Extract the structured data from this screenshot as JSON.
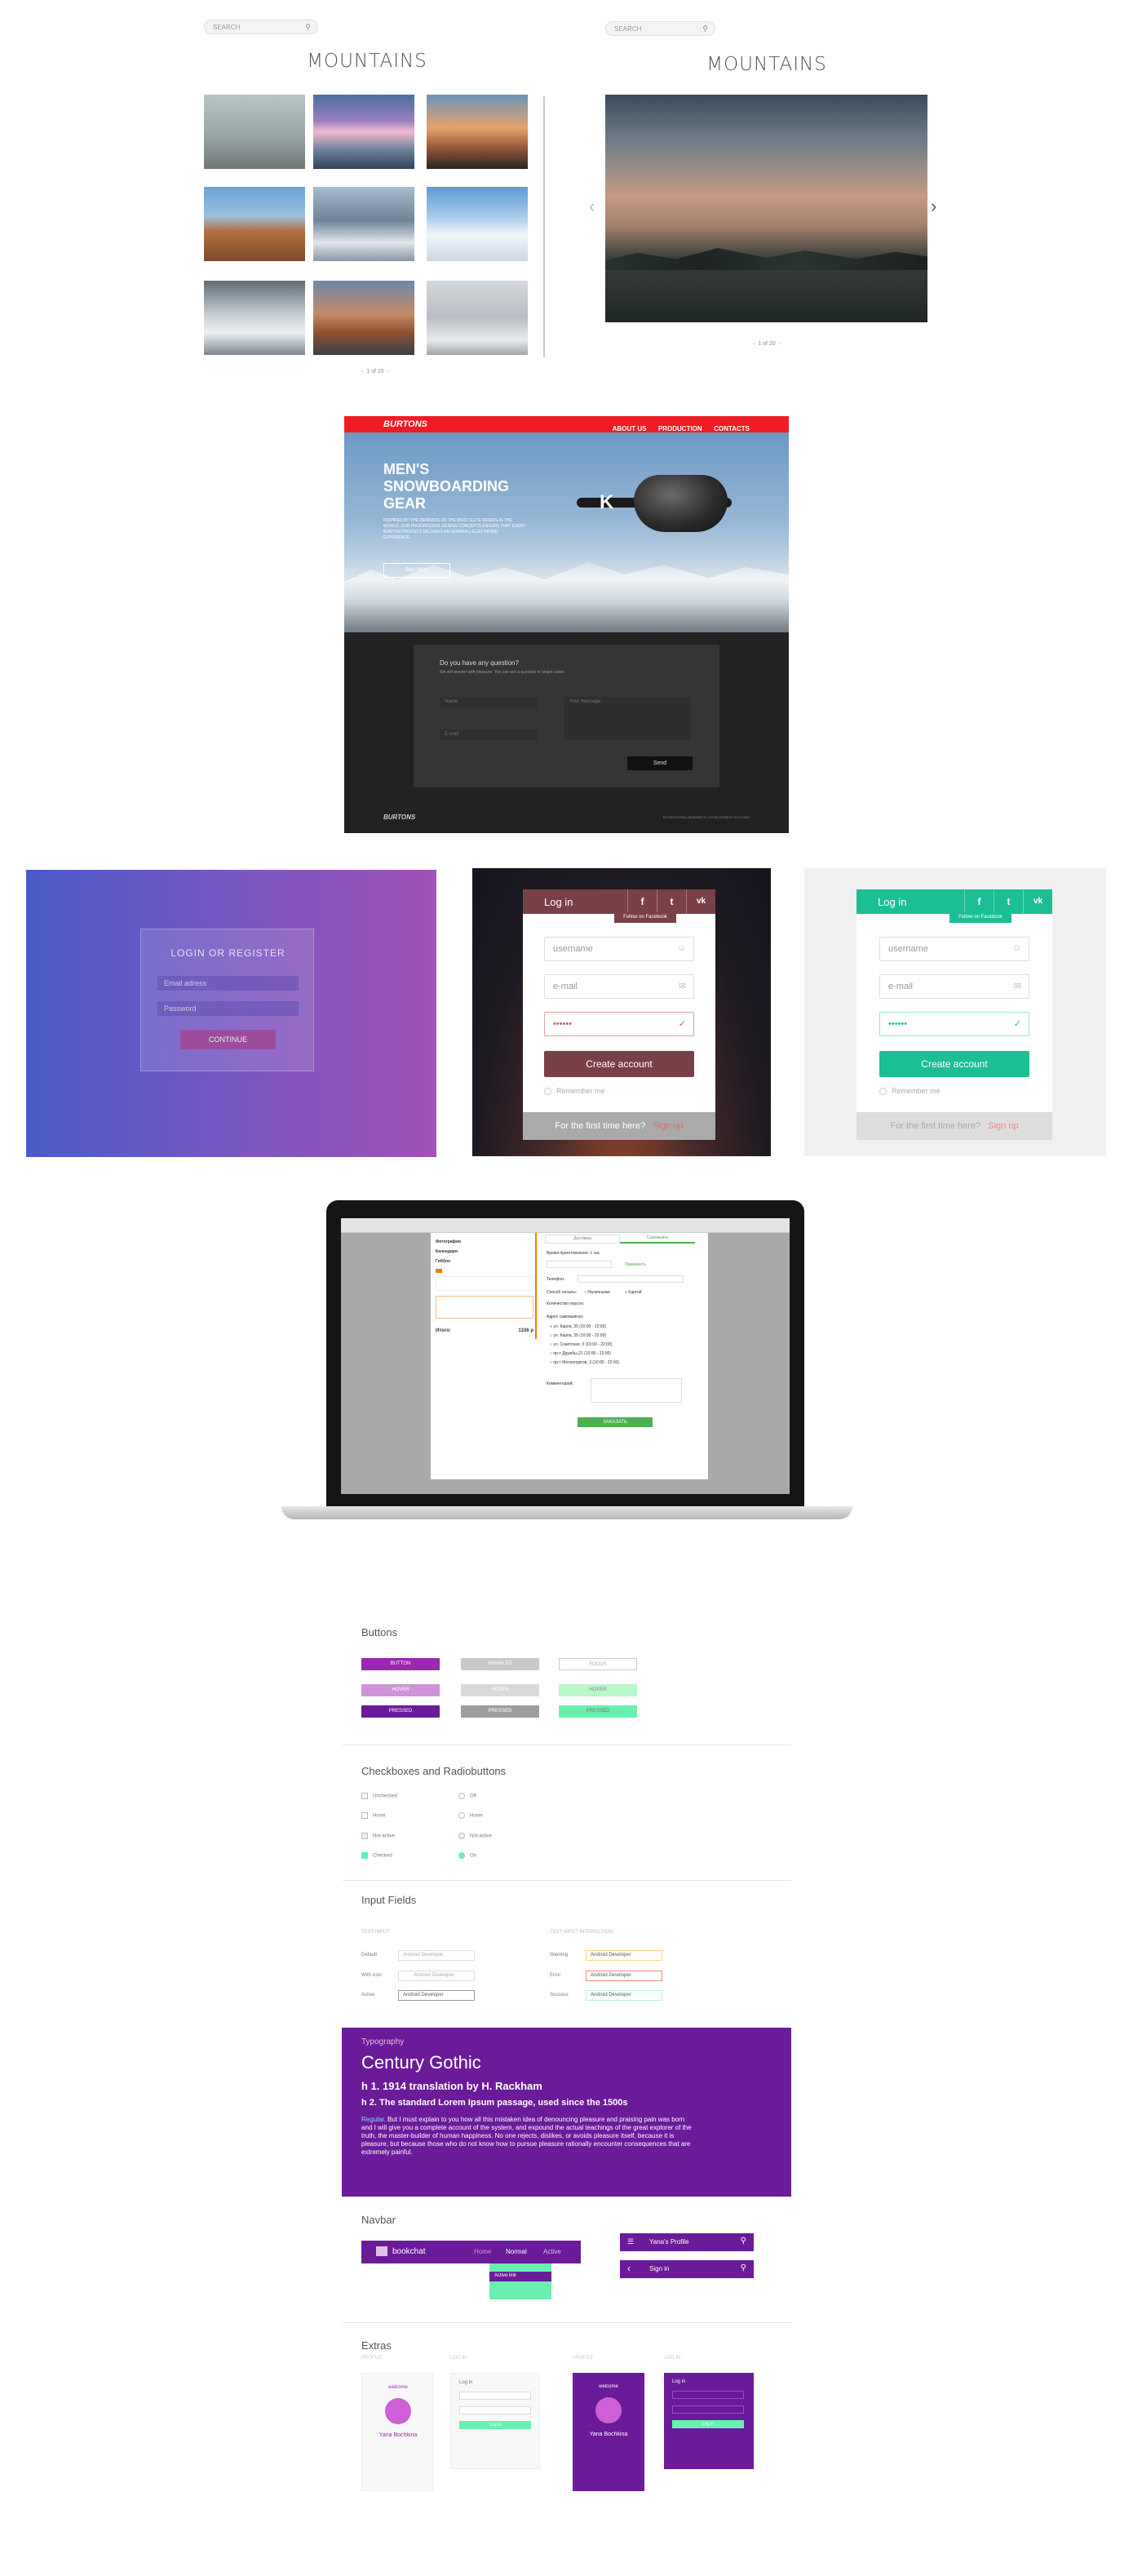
{
  "gallery_left": {
    "search_placeholder": "SEARCH",
    "title": "MOUNTAINS",
    "pager": "1 of 20"
  },
  "gallery_right": {
    "search_placeholder": "SEARCH",
    "title": "MOUNTAINS",
    "pager": "1 of 20"
  },
  "burton": {
    "logo": "BURTONS",
    "nav": [
      "ABOUT US",
      "PRODUCTION",
      "CONTACTS"
    ],
    "hero_title_1": "MEN'S",
    "hero_title_2": "SNOWBOARDING",
    "hero_title_3": "GEAR",
    "hero_text": "INSPIRED BY THE DEMANDS OF THE MOST ELITE RIDERS IN THE WORLD, OUR PROGRESSIVE DESIGN CONCEPTS ENSURE THAT EVERY BURTON PRODUCT DELIVERS AN UNPARALLELED RIDING EXPERIENCE.",
    "buy_button": "Buy Now",
    "form_title": "Do you have any question?",
    "form_sub": "We will answer with pleasure. You can ask a question in shape under.",
    "name_placeholder": "Name",
    "email_placeholder": "E-mail",
    "message_placeholder": "Your message",
    "send_button": "Send",
    "footer_logo": "BURTONS",
    "footer_text": "BY INDUSTRIAL ELEMENTS | DEVELOPMENT BY ICONS"
  },
  "login_gradient": {
    "title": "LOGIN OR REGISTER",
    "email_placeholder": "Email adress",
    "password_placeholder": "Password",
    "button": "CONTINUE"
  },
  "login_dark": {
    "header": "Log in",
    "tooltip": "Follow on Facebook",
    "username": "username",
    "email": "e-mail",
    "password": "••••••",
    "button": "Create account",
    "remember": "Remember me",
    "footer_text": "For the first time here?",
    "footer_link": "Sign up"
  },
  "login_green": {
    "header": "Log in",
    "tooltip": "Follow on Facebook",
    "username": "username",
    "email": "e-mail",
    "password": "••••••",
    "button": "Create account",
    "remember": "Remember me",
    "footer_text": "For the first time here?",
    "footer_link": "Sign up",
    "accent": "#1cbf95"
  },
  "laptop": {
    "tab_delivery": "Доставка",
    "tab_pickup": "Самовывоз",
    "items": [
      "Фотография",
      "Календари",
      "Гиббон"
    ],
    "total_label": "Итого:",
    "total_value": "1336 р",
    "time_label": "Время приготовления: 1 час",
    "apply": "Применить",
    "phone_label": "Телефон:",
    "payment_label": "Способ оплаты:",
    "payment_opts": [
      "Наличными",
      "Картой"
    ],
    "persons_label": "Количество персон:",
    "address_label": "Адрес самовывоза:",
    "addresses": [
      "ул. Карла, 35 (10:00 - 22:00)",
      "ул. Карла, 35 (10:00 - 22:00)",
      "ул. Советская, 3 (10:00 - 22:00)",
      "пр-т Дружбы,21 (10:00 - 22:00)",
      "пр-т Металлургов, 3 (10:00 - 22:00)"
    ],
    "comment_label": "Комментарий:",
    "order_button": "ЗАКАЗАТЬ"
  },
  "guide": {
    "buttons_title": "Buttons",
    "btn_labels": [
      "BUTTON",
      "HOVER",
      "PRESSED"
    ],
    "btn_labels_grey": [
      "DISABLED",
      "HOVER",
      "PRESSED"
    ],
    "btn_labels_green": [
      "FOCUS",
      "HOVER",
      "PRESSED"
    ],
    "checks_title": "Checkboxes and Radiobuttons",
    "check_labels": [
      "Unchecked",
      "Hover",
      "Not-active",
      "Checked"
    ],
    "radio_labels": [
      "Off",
      "Hover",
      "Not-active",
      "On"
    ],
    "inputs_title": "Input Fields",
    "inputs_col1": "TEXT INPUT",
    "inputs_col2": "TEXT INPUT INTERACTION",
    "input_rows_left": [
      "Default",
      "With icon",
      "Active"
    ],
    "input_rows_right": [
      "Warning",
      "Error",
      "Success"
    ],
    "input_value": "Android Developer",
    "input_placeholder": "Android Developer",
    "typo_label": "Typography",
    "typo_font": "Century Gothic",
    "typo_h1": "h 1. 1914 translation by H. Rackham",
    "typo_h2": "h 2. The standard Lorem Ipsum passage, used since the 1500s",
    "typo_regular_label": "Regular.",
    "typo_body": "But I must explain to you how all this mistaken idea of denouncing pleasure and praising pain was born and I will give you a complete account of the system, and expound the actual teachings of the great explorer of the truth, the master-builder of human happiness. No one rejects, dislikes, or avoids pleasure itself, because it is pleasure, but because those who do not know how to pursue pleasure rationally encounter consequences that are extremely painful.",
    "navbar_title": "Navbar",
    "navbar_brand": "bookchat",
    "navbar_items": [
      "Home",
      "Normal",
      "Active"
    ],
    "dropdown_item": "Active link",
    "profile_bar": "Yana's Profile",
    "signin_bar": "Sign in",
    "extras_title": "Extras",
    "extra_labels": [
      "PROFILE",
      "LOG IN",
      "PROFILE",
      "LOG IN"
    ],
    "welcome": "welcome",
    "profile_name": "Yana Bochkina",
    "login_label": "Log in",
    "login_btn": "Log in",
    "accent_purple": "#6a1b9a",
    "accent_green": "#69f0ae"
  }
}
